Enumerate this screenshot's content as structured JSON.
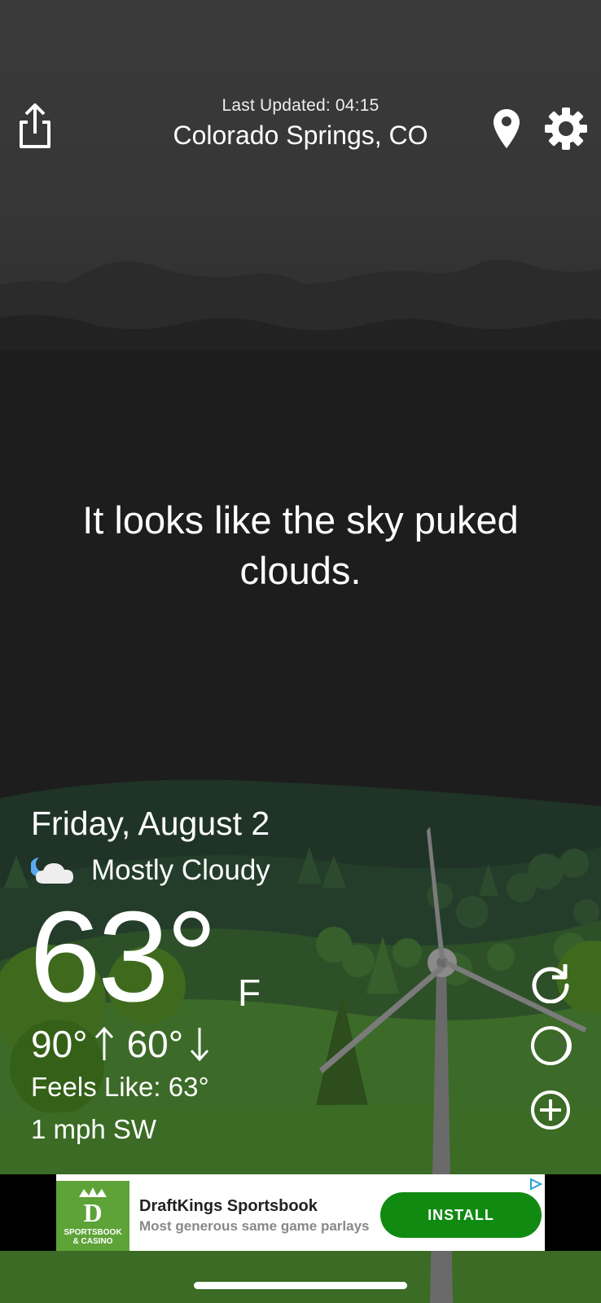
{
  "header": {
    "last_updated": "Last Updated: 04:15",
    "city": "Colorado Springs, CO"
  },
  "quip": "It looks like the sky puked clouds.",
  "weather": {
    "date": "Friday, August 2",
    "condition": "Mostly Cloudy",
    "condition_icon": "partly-cloudy-night-icon",
    "temperature": "63°",
    "unit": "F",
    "high": "90°",
    "low": "60°",
    "feels_like": "Feels Like: 63°",
    "wind": "1 mph SW"
  },
  "ad": {
    "logo_text_line1": "SPORTSBOOK",
    "logo_text_line2": "& CASINO",
    "title": "DraftKings Sportsbook",
    "subtitle": "Most generous same game parlays",
    "install_label": "INSTALL",
    "accent_color": "#118a12",
    "logo_color": "#5ea337"
  },
  "icons": {
    "share": "share-icon",
    "location": "location-pin-icon",
    "settings": "gear-icon",
    "refresh": "refresh-icon",
    "moon": "moon-phase-icon",
    "add": "add-circle-icon"
  }
}
